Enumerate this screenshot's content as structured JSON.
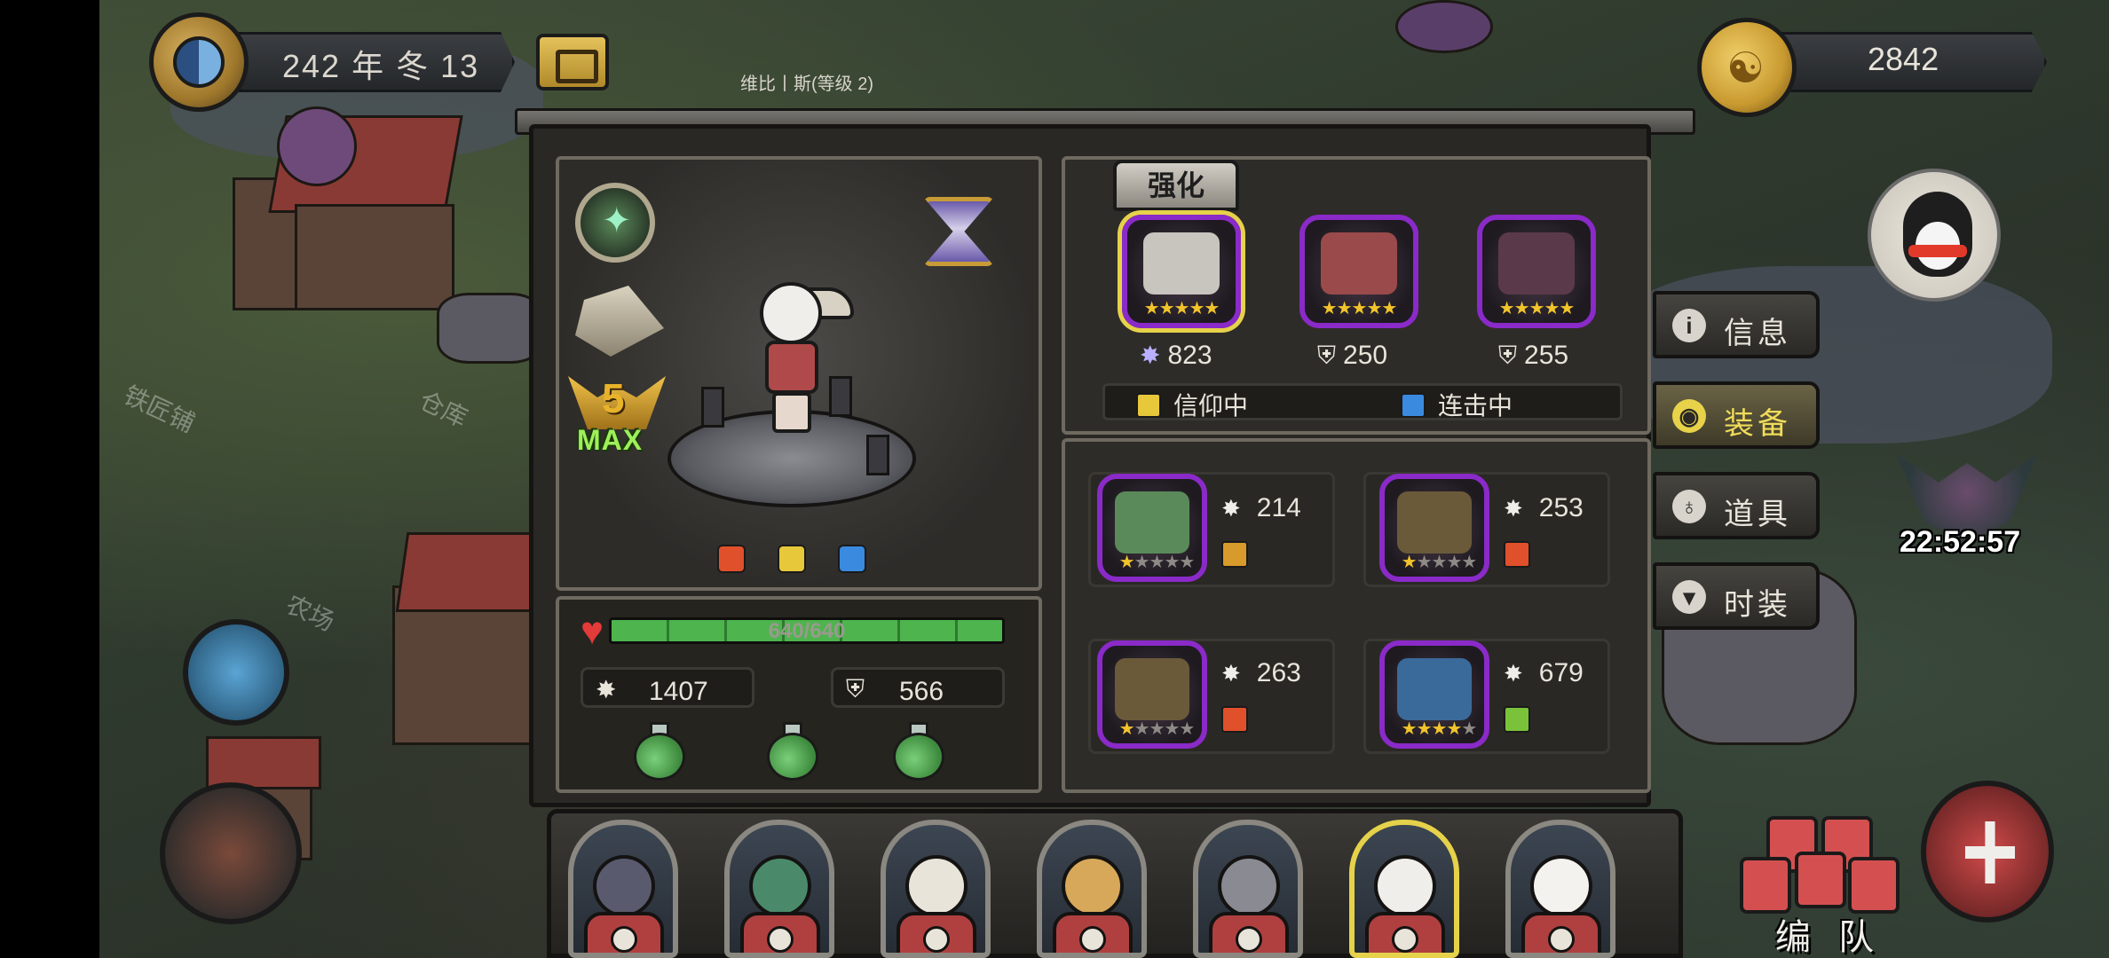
{
  "top_left": {
    "date": "242 年 冬 13"
  },
  "top_right": {
    "gold": "2842",
    "coin_glyph": "☯"
  },
  "boss": {
    "timer": "22:52:57"
  },
  "frame_title": "维比丨斯(等级 2)",
  "world_labels": [
    "铁匠铺",
    "仓库",
    "农场"
  ],
  "hero": {
    "level": "5",
    "max_label": "MAX",
    "hp_current": 640,
    "hp_max": 640,
    "hp_text": "640/640",
    "attack": "1407",
    "defense": "566",
    "potions": 3
  },
  "equipment": {
    "enhance_label": "强化",
    "gear": [
      {
        "stat": "823",
        "stat_type": "attack-burst",
        "stars": 5,
        "selected": true
      },
      {
        "stat": "250",
        "stat_type": "defense",
        "stars": 5,
        "selected": false
      },
      {
        "stat": "255",
        "stat_type": "defense",
        "stars": 5,
        "selected": false
      }
    ],
    "status": [
      {
        "label": "信仰中",
        "color": "#e7c83a"
      },
      {
        "label": "连击中",
        "color": "#3a8ae0"
      }
    ],
    "items": [
      {
        "stat": "214",
        "stars_on": 1,
        "badge_color": "#d89a2a"
      },
      {
        "stat": "253",
        "stars_on": 1,
        "badge_color": "#e0502a"
      },
      {
        "stat": "263",
        "stars_on": 1,
        "badge_color": "#e0502a"
      },
      {
        "stat": "679",
        "stars_on": 4,
        "badge_color": "#7ac23a"
      }
    ]
  },
  "side_tabs": [
    {
      "label": "信息",
      "icon": "info-icon",
      "glyph": "i",
      "active": false
    },
    {
      "label": "装备",
      "icon": "armor-icon",
      "glyph": "◉",
      "active": true
    },
    {
      "label": "道具",
      "icon": "potion-icon",
      "glyph": "♁",
      "active": false
    },
    {
      "label": "时装",
      "icon": "shirt-icon",
      "glyph": "▾",
      "active": false
    }
  ],
  "roster": {
    "team_label": "编 队",
    "heroes": [
      {
        "name": "pirate-boar",
        "face": "#5a5a6e",
        "selected": false
      },
      {
        "name": "crocodile",
        "face": "#4a8a6a",
        "selected": false
      },
      {
        "name": "eagle",
        "face": "#e8e4da",
        "selected": false
      },
      {
        "name": "giraffe",
        "face": "#d8a85a",
        "selected": false
      },
      {
        "name": "elephant",
        "face": "#8a8a92",
        "selected": false
      },
      {
        "name": "sheep-girl",
        "face": "#f0eeea",
        "selected": true
      },
      {
        "name": "polar-bear",
        "face": "#f4f2ee",
        "selected": false
      }
    ]
  },
  "colors": {
    "accent_gold": "#e6d24a",
    "gear_border": "#8a2ac8",
    "hp_green": "#4eb44e"
  }
}
